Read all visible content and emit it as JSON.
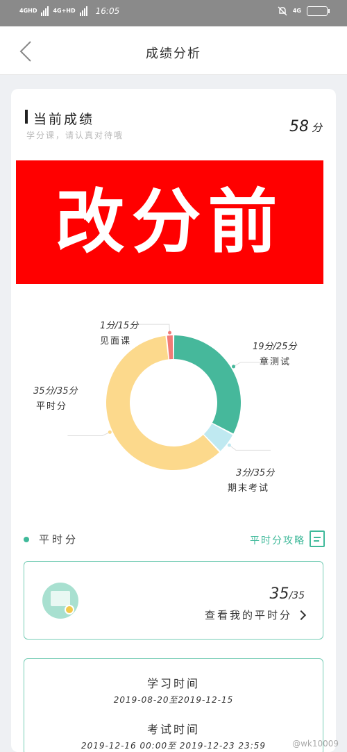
{
  "status_bar": {
    "network1": "4GHD",
    "network2": "4G+HD",
    "time": "16:05",
    "network_right": "4G",
    "battery": "▯"
  },
  "nav": {
    "title": "成绩分析",
    "back_icon": "chevron-left-icon"
  },
  "score": {
    "title": "当前成绩",
    "subtitle": "学分课，请认真对待哦",
    "value": "58",
    "unit": "分"
  },
  "banner": {
    "text": "改分前"
  },
  "chart_data": {
    "type": "pie",
    "categories": [
      "章测试",
      "期末考试",
      "平时分",
      "见面课"
    ],
    "values": [
      19,
      3,
      35,
      1
    ],
    "totals": [
      25,
      35,
      35,
      15
    ],
    "labels": [
      "19分/25分",
      "3分/35分",
      "35分/35分",
      "1分/15分"
    ],
    "colors": [
      "#46b89b",
      "#bfe9f1",
      "#fcd98c",
      "#f27b76"
    ]
  },
  "ordinary": {
    "title": "平时分",
    "link": "平时分攻略",
    "score": "35",
    "total": "/35",
    "view_link": "查看我的平时分"
  },
  "time_card": {
    "study_label": "学习时间",
    "study_value": "2019-08-20至2019-12-15",
    "exam_label": "考试时间",
    "exam_value": "2019-12-16 00:00至 2019-12-23 23:59"
  },
  "watermark": "@wk10009"
}
